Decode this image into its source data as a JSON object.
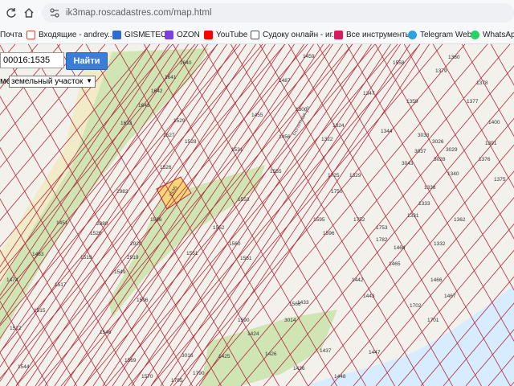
{
  "browser": {
    "url": "ik3map.roscadastres.com/map.html",
    "bookmarks": [
      {
        "label": "Почта",
        "color": "#ffffff"
      },
      {
        "label": "Входящие - andrey...",
        "color": "#ea4335"
      },
      {
        "label": "GISMETEO",
        "color": "#2d6bd2"
      },
      {
        "label": "OZON",
        "color": "#7b3fe4"
      },
      {
        "label": "YouTube",
        "color": "#ff0000"
      },
      {
        "label": "Судоку онлайн - иг...",
        "color": "#555555"
      },
      {
        "label": "Все инструменты",
        "color": "#d81b60"
      },
      {
        "label": "Telegram Web",
        "color": "#2aa3df"
      },
      {
        "label": "WhatsApp",
        "color": "#25d366"
      }
    ]
  },
  "search": {
    "input_value": "00016:1535",
    "button_label": "Найти",
    "type_label": "ме:",
    "type_value": "земельный участок"
  },
  "map": {
    "street": "Болотная ул",
    "plots": [
      "1558",
      "1380",
      "1378",
      "1377",
      "1379",
      "1359",
      "1347",
      "1344",
      "1324",
      "1322",
      "1456",
      "1455",
      "1300",
      "1487",
      "1459",
      "1400",
      "1391",
      "1376",
      "1375",
      "1451",
      "1463",
      "1474",
      "1517",
      "1515",
      "1512",
      "1544",
      "1535",
      "1536",
      "1551",
      "1552",
      "1553",
      "1555",
      "1560",
      "1561",
      "1566",
      "1569",
      "1570",
      "1590",
      "1595",
      "1596",
      "1433",
      "1442",
      "1443",
      "1447",
      "1448",
      "1464",
      "1465",
      "1466",
      "1467",
      "1436",
      "1437",
      "1424",
      "1425",
      "1426",
      "1702",
      "1701",
      "1640",
      "1641",
      "1642",
      "1643",
      "1633",
      "1529",
      "1527",
      "1528",
      "1531",
      "1526",
      "1519",
      "1520",
      "2982",
      "2880",
      "2920",
      "2919",
      "3043",
      "3037",
      "3033",
      "3026",
      "3029",
      "3028",
      "1340",
      "1362",
      "1332",
      "1333",
      "1338",
      "1331",
      "1329",
      "1725",
      "1750",
      "1752",
      "1753",
      "1782",
      "1790",
      "1795",
      "3014",
      "3016",
      "1506",
      "1546",
      "1549",
      "1548",
      "2920"
    ]
  },
  "colors": {
    "plot_line": "#b2293c",
    "highlight_fill": "#f7d67a",
    "green": "#cfe5b4",
    "river": "#d8ecff",
    "search_button": "#3b7dd8"
  }
}
